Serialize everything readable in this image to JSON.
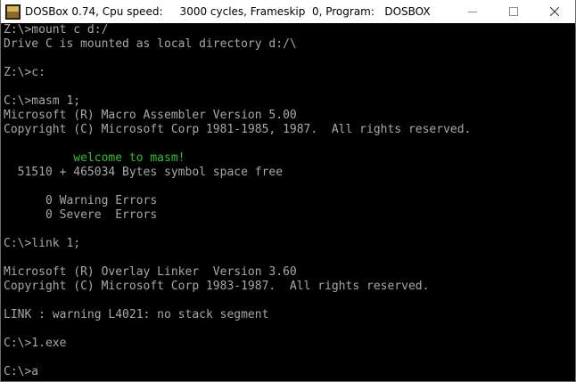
{
  "window": {
    "title": "DOSBox 0.74, Cpu speed:     3000 cycles, Frameskip  0, Program:   DOSBOX",
    "icon": "dosbox-app-icon"
  },
  "controls": {
    "minimize": "minimize-icon",
    "maximize": "maximize-icon",
    "close": "close-icon"
  },
  "terminal": {
    "foreground": "#a8a8a8",
    "background": "#000000",
    "highlight": "#2fbf2f",
    "lines": [
      "Z:\\>mount c d:/",
      "Drive C is mounted as local directory d:/\\",
      "",
      "Z:\\>c:",
      "",
      "C:\\>masm 1;",
      "Microsoft (R) Macro Assembler Version 5.00",
      "Copyright (C) Microsoft Corp 1981-1985, 1987.  All rights reserved.",
      "",
      "          welcome to masm!",
      "  51510 + 465034 Bytes symbol space free",
      "",
      "      0 Warning Errors",
      "      0 Severe  Errors",
      "",
      "C:\\>link 1;",
      "",
      "Microsoft (R) Overlay Linker  Version 3.60",
      "Copyright (C) Microsoft Corp 1983-1987.  All rights reserved.",
      "",
      "LINK : warning L4021: no stack segment",
      "",
      "C:\\>1.exe",
      "",
      "C:\\>a"
    ]
  }
}
